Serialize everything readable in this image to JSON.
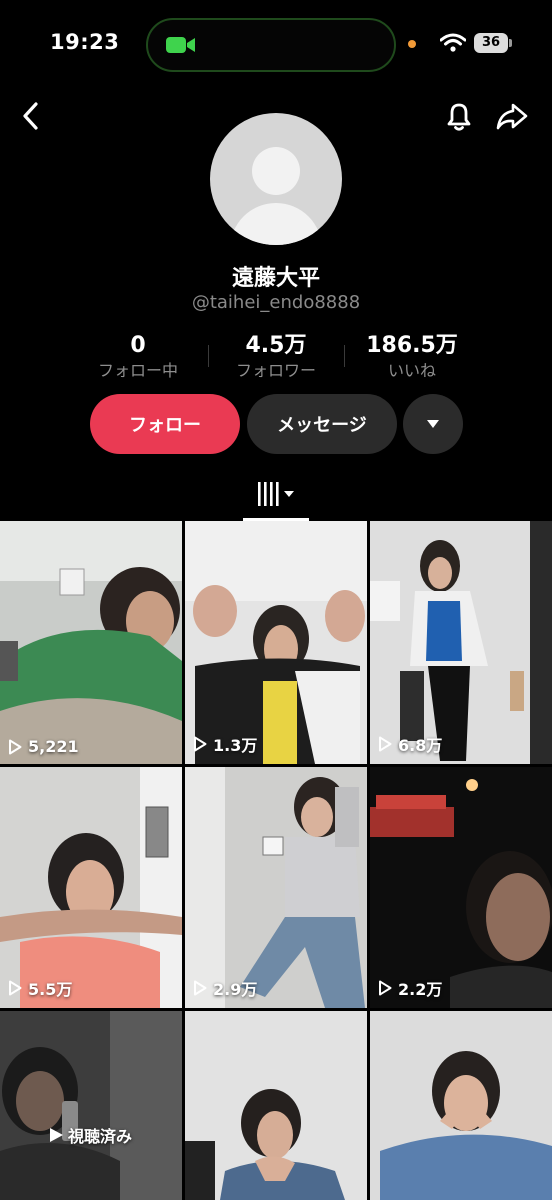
{
  "status_bar": {
    "time": "19:23",
    "battery": "36"
  },
  "profile": {
    "display_name": "遠藤大平",
    "username": "@taihei_endo8888",
    "stats": [
      {
        "value": "0",
        "label": "フォロー中"
      },
      {
        "value": "4.5万",
        "label": "フォロワー"
      },
      {
        "value": "186.5万",
        "label": "いいね"
      }
    ],
    "follow_label": "フォロー",
    "message_label": "メッセージ"
  },
  "videos": [
    {
      "views": "5,221"
    },
    {
      "views": "1.3万"
    },
    {
      "views": "6.8万"
    },
    {
      "views": "5.5万"
    },
    {
      "views": "2.9万"
    },
    {
      "views": "2.2万"
    },
    {
      "views": "",
      "watched_label": "視聴済み"
    },
    {
      "views": ""
    },
    {
      "views": ""
    }
  ],
  "colors": {
    "follow": "#ea3a53",
    "secondary_button": "#2b2b2b",
    "background": "#000000"
  }
}
